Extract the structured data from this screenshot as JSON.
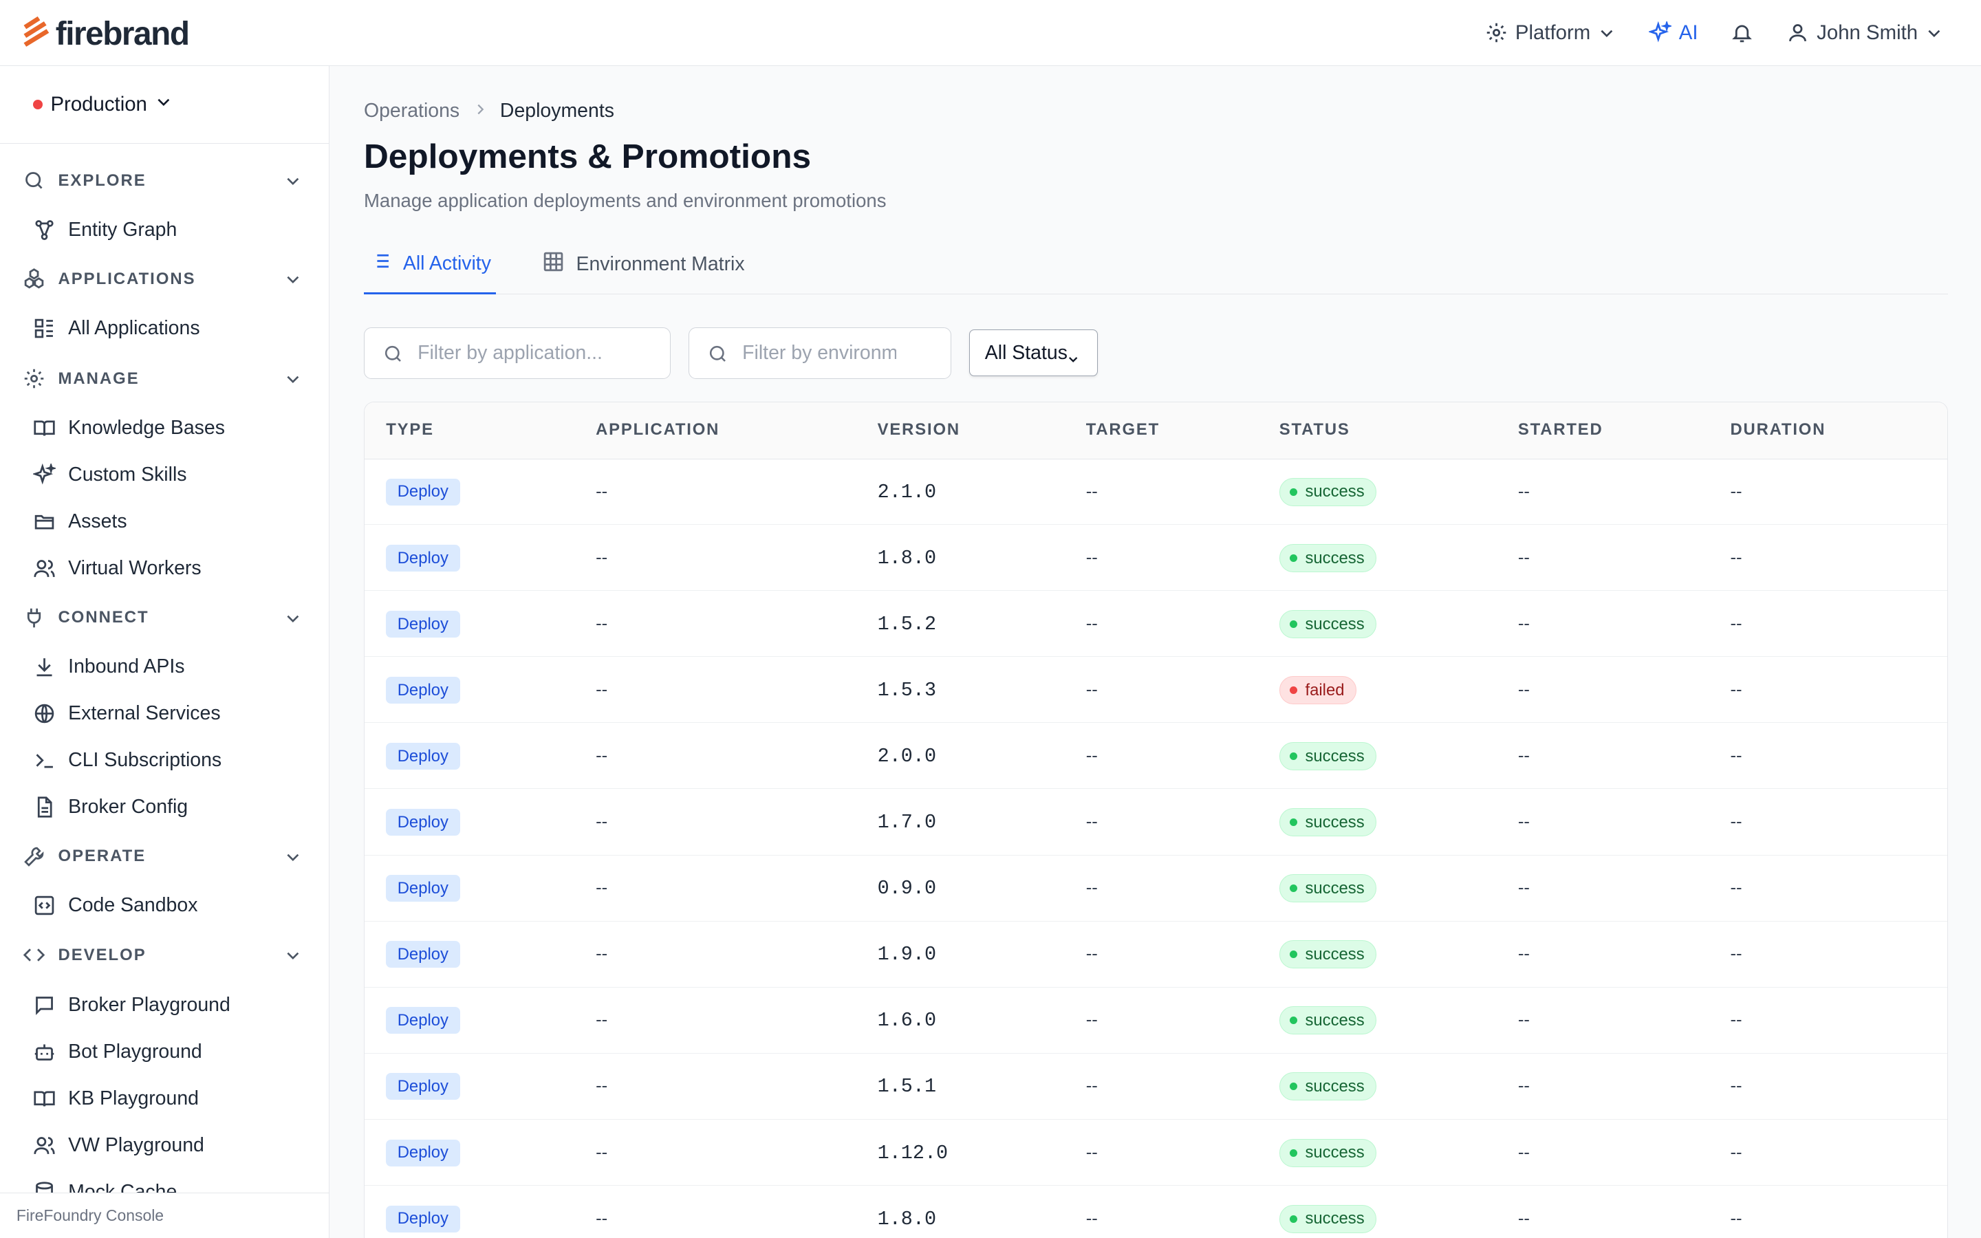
{
  "brand": {
    "name": "firebrand",
    "accent": "#e8672a"
  },
  "topbar": {
    "platform": "Platform",
    "ai": "AI",
    "user": "John Smith"
  },
  "sidebar": {
    "environment": "Production",
    "groups": [
      {
        "label": "EXPLORE",
        "icon": "search-icon",
        "items": [
          {
            "label": "Entity Graph",
            "icon": "graph-icon"
          }
        ]
      },
      {
        "label": "APPLICATIONS",
        "icon": "cubes-icon",
        "items": [
          {
            "label": "All Applications",
            "icon": "dashboard-icon"
          }
        ]
      },
      {
        "label": "MANAGE",
        "icon": "gear-icon",
        "items": [
          {
            "label": "Knowledge Bases",
            "icon": "book-icon"
          },
          {
            "label": "Custom Skills",
            "icon": "sparkle-icon"
          },
          {
            "label": "Assets",
            "icon": "folder-icon"
          },
          {
            "label": "Virtual Workers",
            "icon": "users-icon"
          }
        ]
      },
      {
        "label": "CONNECT",
        "icon": "plug-icon",
        "items": [
          {
            "label": "Inbound APIs",
            "icon": "download-icon"
          },
          {
            "label": "External Services",
            "icon": "globe-icon"
          },
          {
            "label": "CLI Subscriptions",
            "icon": "terminal-icon"
          },
          {
            "label": "Broker Config",
            "icon": "file-icon"
          }
        ]
      },
      {
        "label": "OPERATE",
        "icon": "wrench-icon",
        "items": [
          {
            "label": "Code Sandbox",
            "icon": "code-box-icon"
          }
        ]
      },
      {
        "label": "DEVELOP",
        "icon": "code-icon",
        "items": [
          {
            "label": "Broker Playground",
            "icon": "chat-icon"
          },
          {
            "label": "Bot Playground",
            "icon": "bot-icon"
          },
          {
            "label": "KB Playground",
            "icon": "book-icon"
          },
          {
            "label": "VW Playground",
            "icon": "users-icon"
          },
          {
            "label": "Mock Cache",
            "icon": "database-icon"
          }
        ]
      }
    ],
    "footer": "FireFoundry Console"
  },
  "breadcrumb": {
    "parent": "Operations",
    "current": "Deployments"
  },
  "page": {
    "title": "Deployments & Promotions",
    "subtitle": "Manage application deployments and environment promotions"
  },
  "tabs": [
    {
      "label": "All Activity"
    },
    {
      "label": "Environment Matrix"
    }
  ],
  "filters": {
    "app_placeholder": "Filter by application...",
    "env_placeholder": "Filter by environment...",
    "status": "All Status"
  },
  "table": {
    "columns": [
      "TYPE",
      "APPLICATION",
      "VERSION",
      "TARGET",
      "STATUS",
      "STARTED",
      "DURATION"
    ],
    "rows": [
      {
        "type": "Deploy",
        "application": "--",
        "version": "2.1.0",
        "target": "--",
        "status": "success",
        "started": "--",
        "duration": "--"
      },
      {
        "type": "Deploy",
        "application": "--",
        "version": "1.8.0",
        "target": "--",
        "status": "success",
        "started": "--",
        "duration": "--"
      },
      {
        "type": "Deploy",
        "application": "--",
        "version": "1.5.2",
        "target": "--",
        "status": "success",
        "started": "--",
        "duration": "--"
      },
      {
        "type": "Deploy",
        "application": "--",
        "version": "1.5.3",
        "target": "--",
        "status": "failed",
        "started": "--",
        "duration": "--"
      },
      {
        "type": "Deploy",
        "application": "--",
        "version": "2.0.0",
        "target": "--",
        "status": "success",
        "started": "--",
        "duration": "--"
      },
      {
        "type": "Deploy",
        "application": "--",
        "version": "1.7.0",
        "target": "--",
        "status": "success",
        "started": "--",
        "duration": "--"
      },
      {
        "type": "Deploy",
        "application": "--",
        "version": "0.9.0",
        "target": "--",
        "status": "success",
        "started": "--",
        "duration": "--"
      },
      {
        "type": "Deploy",
        "application": "--",
        "version": "1.9.0",
        "target": "--",
        "status": "success",
        "started": "--",
        "duration": "--"
      },
      {
        "type": "Deploy",
        "application": "--",
        "version": "1.6.0",
        "target": "--",
        "status": "success",
        "started": "--",
        "duration": "--"
      },
      {
        "type": "Deploy",
        "application": "--",
        "version": "1.5.1",
        "target": "--",
        "status": "success",
        "started": "--",
        "duration": "--"
      },
      {
        "type": "Deploy",
        "application": "--",
        "version": "1.12.0",
        "target": "--",
        "status": "success",
        "started": "--",
        "duration": "--"
      },
      {
        "type": "Deploy",
        "application": "--",
        "version": "1.8.0",
        "target": "--",
        "status": "success",
        "started": "--",
        "duration": "--"
      }
    ]
  }
}
